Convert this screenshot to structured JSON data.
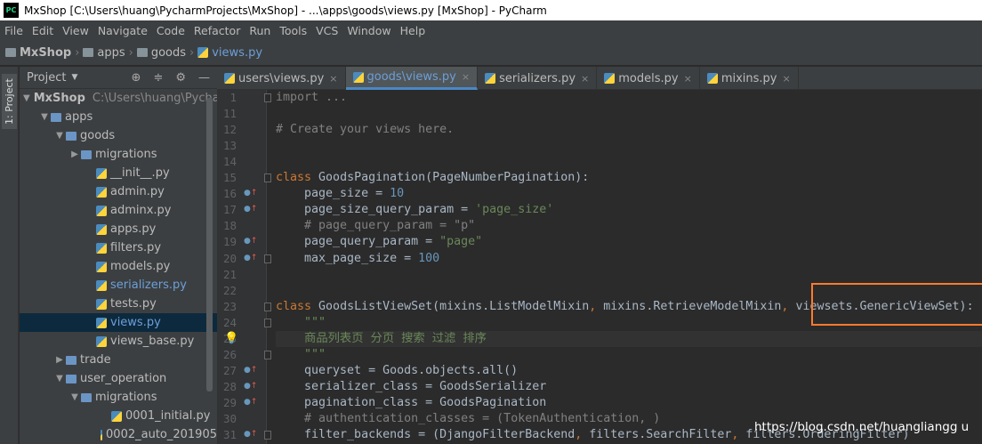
{
  "window_title": "MxShop [C:\\Users\\huang\\PycharmProjects\\MxShop] - ...\\apps\\goods\\views.py [MxShop] - PyCharm",
  "app_icon": "PC",
  "menu": [
    "File",
    "Edit",
    "View",
    "Navigate",
    "Code",
    "Refactor",
    "Run",
    "Tools",
    "VCS",
    "Window",
    "Help"
  ],
  "breadcrumb": [
    "MxShop",
    "apps",
    "goods",
    "views.py"
  ],
  "tool_window_label": "1: Project",
  "project_panel": {
    "title": "Project"
  },
  "tree": [
    {
      "label": "MxShop",
      "path": "C:\\Users\\huang\\Pycha",
      "depth": 0,
      "arrow": "▼",
      "type": "folder"
    },
    {
      "label": "apps",
      "depth": 1,
      "arrow": "▼",
      "type": "folder"
    },
    {
      "label": "goods",
      "depth": 2,
      "arrow": "▼",
      "type": "folder"
    },
    {
      "label": "migrations",
      "depth": 3,
      "arrow": "▶",
      "type": "folder"
    },
    {
      "label": "__init__.py",
      "depth": 4,
      "type": "py"
    },
    {
      "label": "admin.py",
      "depth": 4,
      "type": "py"
    },
    {
      "label": "adminx.py",
      "depth": 4,
      "type": "py"
    },
    {
      "label": "apps.py",
      "depth": 4,
      "type": "py"
    },
    {
      "label": "filters.py",
      "depth": 4,
      "type": "py"
    },
    {
      "label": "models.py",
      "depth": 4,
      "type": "py"
    },
    {
      "label": "serializers.py",
      "depth": 4,
      "type": "py",
      "color": "#6c9fd8"
    },
    {
      "label": "tests.py",
      "depth": 4,
      "type": "py"
    },
    {
      "label": "views.py",
      "depth": 4,
      "type": "py",
      "color": "#6c9fd8",
      "selected": true
    },
    {
      "label": "views_base.py",
      "depth": 4,
      "type": "py"
    },
    {
      "label": "trade",
      "depth": 2,
      "arrow": "▶",
      "type": "folder"
    },
    {
      "label": "user_operation",
      "depth": 2,
      "arrow": "▼",
      "type": "folder"
    },
    {
      "label": "migrations",
      "depth": 3,
      "arrow": "▼",
      "type": "folder"
    },
    {
      "label": "0001_initial.py",
      "depth": 5,
      "type": "py"
    },
    {
      "label": "0002_auto_201905",
      "depth": 5,
      "type": "py"
    }
  ],
  "tabs": [
    {
      "label": "users\\views.py",
      "active": false
    },
    {
      "label": "goods\\views.py",
      "active": true
    },
    {
      "label": "serializers.py",
      "active": false
    },
    {
      "label": "models.py",
      "active": false
    },
    {
      "label": "mixins.py",
      "active": false
    }
  ],
  "code_lines": [
    {
      "n": "1",
      "html": "<span class='cm'>import ...</span>"
    },
    {
      "n": "11",
      "html": ""
    },
    {
      "n": "12",
      "html": "<span class='cm'># Create your views here.</span>"
    },
    {
      "n": "13",
      "html": ""
    },
    {
      "n": "14",
      "html": ""
    },
    {
      "n": "15",
      "html": "<span class='kw'>class </span>GoodsPagination(PageNumberPagination):"
    },
    {
      "n": "16",
      "html": "    page_size = <span class='nu'>10</span>",
      "mark": true
    },
    {
      "n": "17",
      "html": "    page_size_query_param = <span class='st'>'page_size'</span>",
      "mark": true
    },
    {
      "n": "18",
      "html": "    <span class='cm'># page_query_param = \"p\"</span>"
    },
    {
      "n": "19",
      "html": "    page_query_param = <span class='st'>\"page\"</span>",
      "mark": true
    },
    {
      "n": "20",
      "html": "    max_page_size = <span class='nu'>100</span>",
      "mark": true
    },
    {
      "n": "21",
      "html": ""
    },
    {
      "n": "22",
      "html": ""
    },
    {
      "n": "23",
      "html": "<span class='kw'>class </span>GoodsListViewSet(mixins.ListModelMixin<span class='kw'>, </span>mixins.RetrieveModelMixin<span class='kw'>, </span>viewsets.GenericViewSet):"
    },
    {
      "n": "24",
      "html": "    <span class='st'>\"\"\"</span>"
    },
    {
      "n": "25",
      "html": "    <span class='st'>商品列表页 分页 搜索 过滤 排序</span>",
      "bulb": true
    },
    {
      "n": "26",
      "html": "    <span class='st'>\"\"\"</span>"
    },
    {
      "n": "27",
      "html": "    queryset = Goods.objects.all()",
      "mark": true
    },
    {
      "n": "28",
      "html": "    serializer_class = GoodsSerializer",
      "mark": true
    },
    {
      "n": "29",
      "html": "    pagination_class = GoodsPagination",
      "mark": true
    },
    {
      "n": "30",
      "html": "    <span class='cm'># authentication_classes = (TokenAuthentication, )</span>"
    },
    {
      "n": "31",
      "html": "    filter_backends = (DjangoFilterBackend<span class='kw'>, </span>filters.SearchFilter<span class='kw'>, </span>filters.OrderingFilter)",
      "mark": true
    }
  ],
  "watermark": "https://blog.csdn.net/huangliangg u",
  "highlight_color": "#ff7a2e",
  "accent_color": "#4a88c7"
}
